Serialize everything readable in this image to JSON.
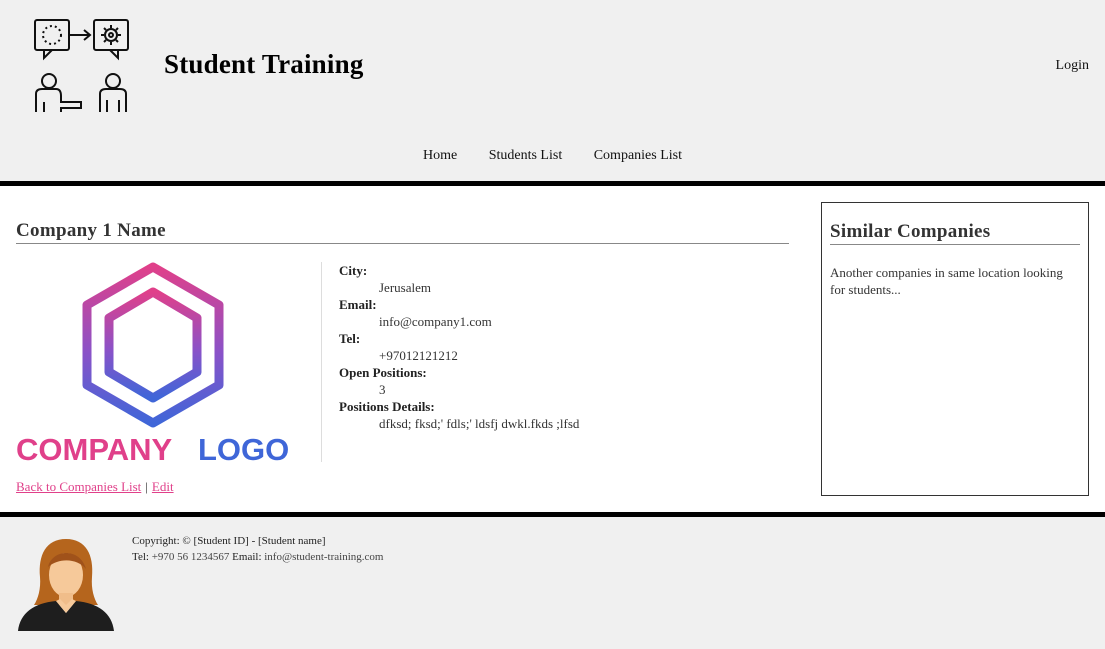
{
  "header": {
    "site_title": "Student Training",
    "login_label": "Login"
  },
  "nav": {
    "items": [
      {
        "label": "Home"
      },
      {
        "label": "Students List"
      },
      {
        "label": "Companies List"
      }
    ]
  },
  "company": {
    "name": "Company 1 Name",
    "logo_text_1": "COMPANY",
    "logo_text_2": "LOGO",
    "details": [
      {
        "label": "City:",
        "value": "Jerusalem"
      },
      {
        "label": "Email:",
        "value": "info@company1.com"
      },
      {
        "label": "Tel:",
        "value": "+97012121212"
      },
      {
        "label": "Open Positions:",
        "value": "3"
      },
      {
        "label": "Positions Details:",
        "value": "dfksd; fksd;' fdls;' ldsfj dwkl.fkds ;lfsd"
      }
    ],
    "back_link": "Back to Companies List",
    "separator": "|",
    "edit_link": "Edit"
  },
  "sidebar": {
    "title": "Similar Companies",
    "text": "Another companies in same location looking for students..."
  },
  "footer": {
    "copyright": "Copyright: © [Student ID] - [Student name]",
    "tel_label": "Tel:",
    "tel_value": "+970 56 1234567",
    "email_label": "Email:",
    "email_value": "info@student-training.com"
  },
  "colors": {
    "accent_pink": "#e0408a",
    "logo_blue": "#3f66d8",
    "bar": "#000000"
  }
}
